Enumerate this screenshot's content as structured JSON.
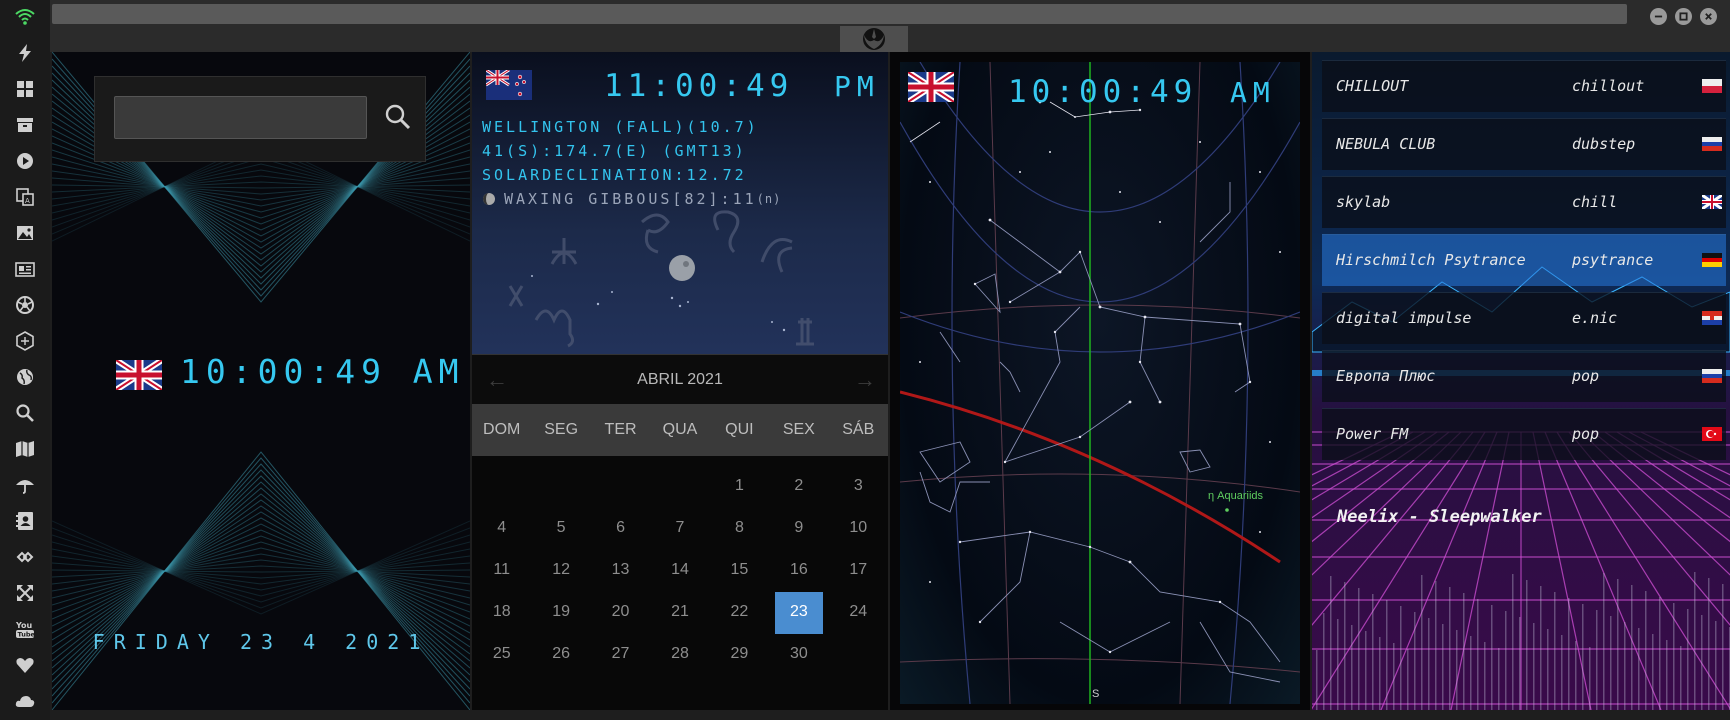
{
  "topbar": {
    "url": ""
  },
  "sidebar": {
    "icons": [
      "wifi-icon",
      "lightning-icon",
      "windows-icon",
      "archive-icon",
      "play-icon",
      "translate-icon",
      "image-icon",
      "news-icon",
      "aperture-icon",
      "hexagon-icon",
      "globe-icon",
      "search-icon",
      "map-icon",
      "umbrella-icon",
      "contact-icon",
      "link-icon",
      "expand-icon",
      "youtube-icon",
      "heart-icon",
      "cloud-icon"
    ]
  },
  "home_clock": {
    "time": "10:00:49 AM",
    "date": "FRIDAY 23 4 2021",
    "search_placeholder": ""
  },
  "world_clock": {
    "time": "11:00:49",
    "ampm": "PM",
    "line1": "WELLINGTON (FALL)(10.7)",
    "line2": "41(S):174.7(E) (GMT13)",
    "line3": "SOLARDECLINATION:12.72",
    "moon_phase": "WAXING GIBBOUS[82]:11",
    "moon_suffix": "(n)"
  },
  "calendar": {
    "month": "ABRIL 2021",
    "prev": "←",
    "next": "→",
    "weekdays": [
      "DOM",
      "SEG",
      "TER",
      "QUA",
      "QUI",
      "SEX",
      "SÁB"
    ],
    "days": [
      "",
      "",
      "",
      "",
      "1",
      "2",
      "3",
      "4",
      "5",
      "6",
      "7",
      "8",
      "9",
      "10",
      "11",
      "12",
      "13",
      "14",
      "15",
      "16",
      "17",
      "18",
      "19",
      "20",
      "21",
      "22",
      "23",
      "24",
      "25",
      "26",
      "27",
      "28",
      "29",
      "30"
    ],
    "today": "23"
  },
  "star_map": {
    "time": "10:00:49",
    "ampm": "AM",
    "meteor_label": "η Aquariids",
    "direction_label": "S"
  },
  "radio": {
    "stations": [
      {
        "name": "CHILLOUT",
        "genre": "chillout",
        "flag": "poland"
      },
      {
        "name": "NEBULA CLUB",
        "genre": "dubstep",
        "flag": "russia"
      },
      {
        "name": "skylab",
        "genre": "chill",
        "flag": "uk"
      },
      {
        "name": "Hirschmilch Psytrance",
        "genre": "psytrance",
        "flag": "germany"
      },
      {
        "name": "digital impulse",
        "genre": "e.nic",
        "flag": "croatia"
      },
      {
        "name": "Европа Плюс",
        "genre": "pop",
        "flag": "russia"
      },
      {
        "name": "Power FM",
        "genre": "pop",
        "flag": "turkey"
      }
    ],
    "active_index": 3,
    "now_playing": "Neelix - Sleepwalker"
  },
  "colors": {
    "lcd": "#36c8f0",
    "accent": "#4a8dd0",
    "wifi": "#4cd964"
  }
}
